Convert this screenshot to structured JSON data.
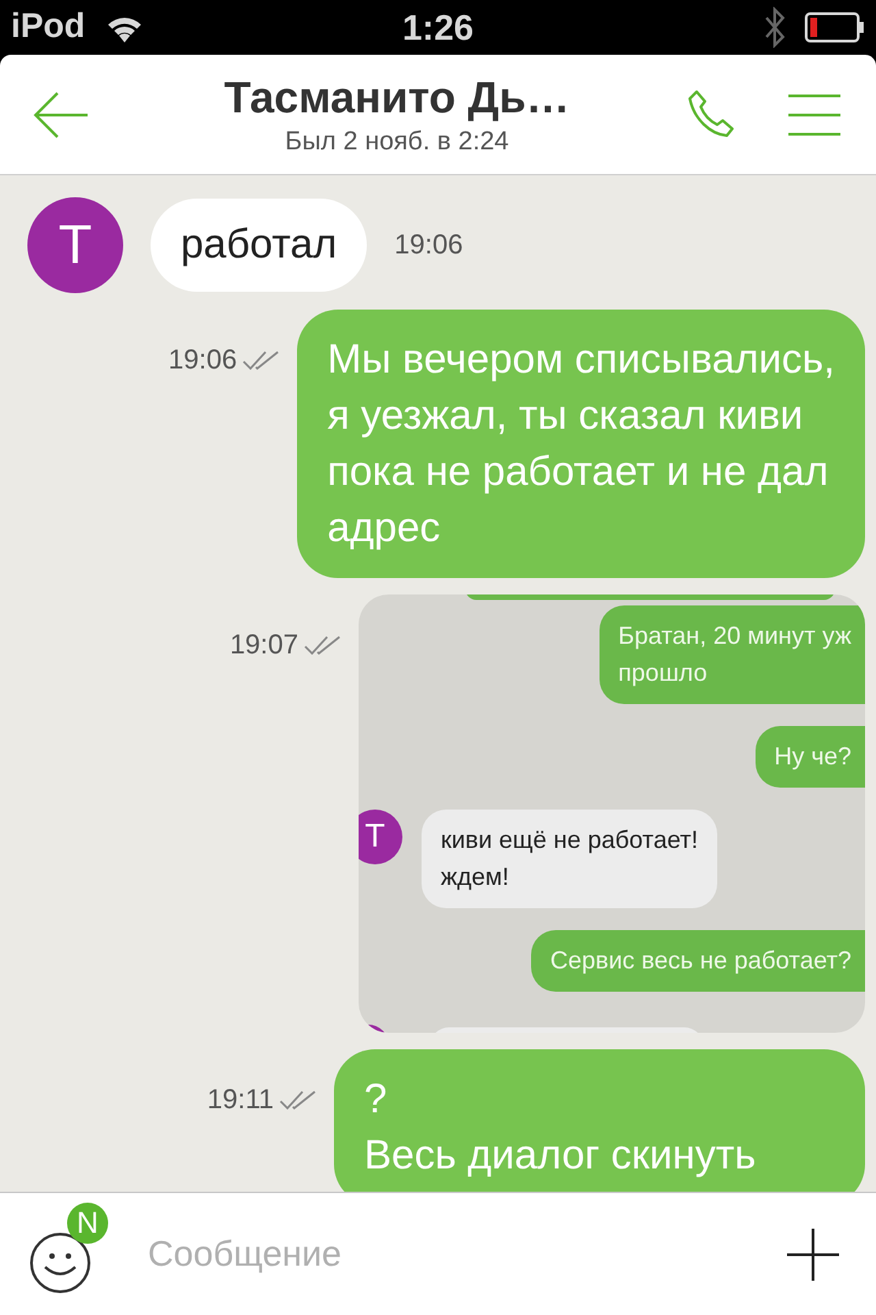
{
  "status_bar": {
    "carrier": "iPod",
    "time": "1:26"
  },
  "header": {
    "title": "Тасманито Дь…",
    "subtitle": "Был 2 нояб. в 2:24"
  },
  "messages": [
    {
      "kind": "incoming",
      "avatar_letter": "T",
      "text": "работал",
      "time": "19:06"
    },
    {
      "kind": "outgoing",
      "text": "Мы вечером списывались,\nя уезжал, ты сказал киви\nпока не работает и не дал\nадрес",
      "time": "19:06"
    },
    {
      "kind": "screenshot",
      "time": "19:07",
      "messages": [
        {
          "kind": "outgoing",
          "text": "Братан, 20 минут уж\nпрошло"
        },
        {
          "kind": "outgoing",
          "text": "Ну че?"
        },
        {
          "kind": "incoming",
          "avatar_letter": "T",
          "text": "киви ещё не работает!\nждем!"
        },
        {
          "kind": "outgoing",
          "text": "Сервис весь не работает?"
        }
      ]
    },
    {
      "kind": "outgoing",
      "text": "?\nВесь диалог скинуть",
      "time": "19:11"
    }
  ],
  "composer": {
    "placeholder": "Сообщение",
    "badge": "N"
  }
}
